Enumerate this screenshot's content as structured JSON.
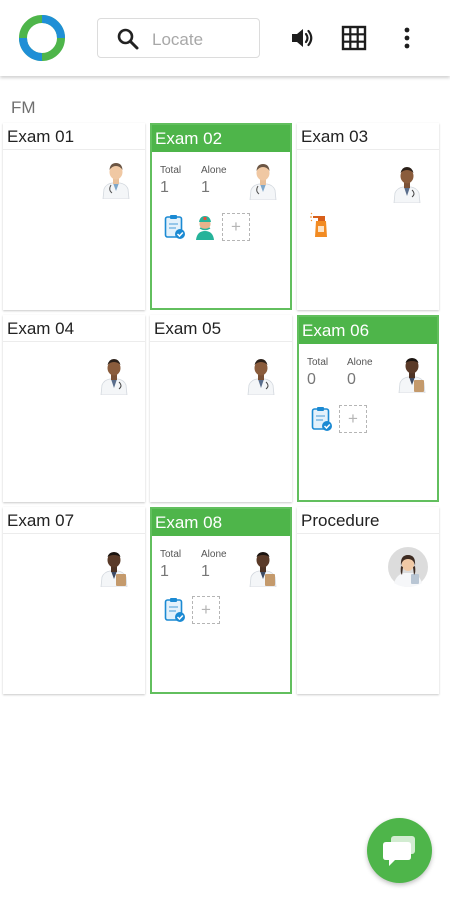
{
  "search": {
    "placeholder": "Locate"
  },
  "section": {
    "title": "FM"
  },
  "rooms": [
    {
      "name": "Exam 01",
      "active": false
    },
    {
      "name": "Exam 02",
      "active": true,
      "total_label": "Total",
      "total": "1",
      "alone_label": "Alone",
      "alone": "1"
    },
    {
      "name": "Exam 03",
      "active": false
    },
    {
      "name": "Exam 04",
      "active": false
    },
    {
      "name": "Exam 05",
      "active": false
    },
    {
      "name": "Exam 06",
      "active": true,
      "total_label": "Total",
      "total": "0",
      "alone_label": "Alone",
      "alone": "0"
    },
    {
      "name": "Exam 07",
      "active": false
    },
    {
      "name": "Exam 08",
      "active": true,
      "total_label": "Total",
      "total": "1",
      "alone_label": "Alone",
      "alone": "1"
    },
    {
      "name": "Procedure",
      "active": false
    }
  ],
  "add_label": "+",
  "colors": {
    "accent": "#4eb54a",
    "accent_border": "#62bf5e",
    "logo_blue": "#1f8fd6"
  },
  "icons": {
    "logo": "ring-logo-icon",
    "search": "search-icon",
    "speaker": "speaker-icon",
    "grid": "grid-icon",
    "more": "more-vertical-icon",
    "clipboard": "clipboard-check-icon",
    "nurse": "nurse-icon",
    "cleaning": "cleaning-spray-icon",
    "chat": "chat-bubble-icon"
  }
}
